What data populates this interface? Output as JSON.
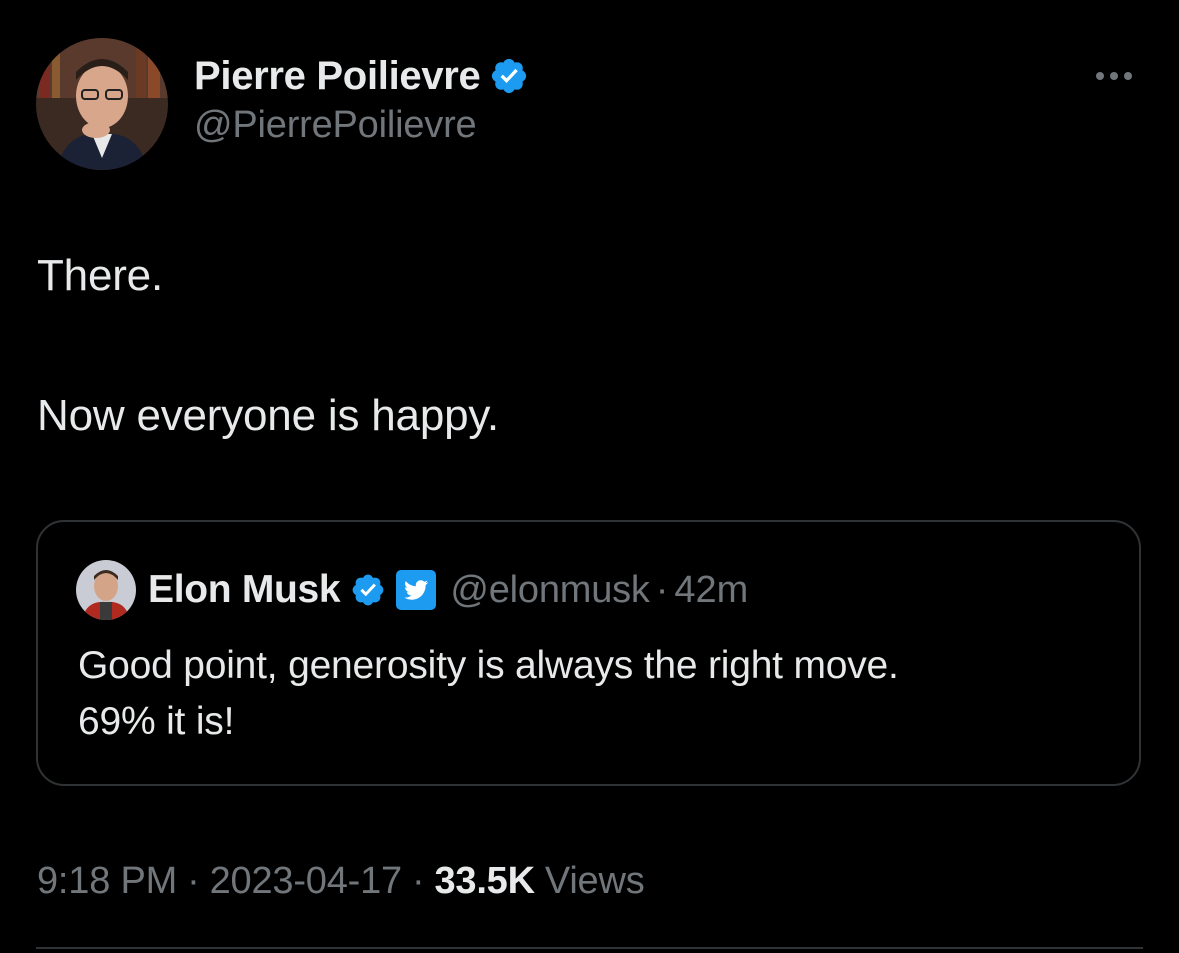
{
  "tweet": {
    "author": {
      "display_name": "Pierre Poilievre",
      "handle": "@PierrePoilievre",
      "verified": true
    },
    "more_icon": "more-horizontal-icon",
    "text_lines": [
      "There.",
      "Now everyone is happy."
    ],
    "quoted": {
      "display_name": "Elon Musk",
      "handle": "@elonmusk",
      "separator": "·",
      "time": "42m",
      "verified": true,
      "affiliate_icon": "twitter-bird-icon",
      "text_lines": [
        "Good point, generosity is always the right move.",
        "69% it is!"
      ]
    },
    "meta": {
      "time": "9:18 PM",
      "sep1": "·",
      "date": "2023-04-17",
      "sep2": "·",
      "views_count": "33.5K",
      "views_label": "Views"
    }
  },
  "colors": {
    "background": "#000000",
    "primary_text": "#e7e9ea",
    "secondary_text": "#71767b",
    "border": "#2f3336",
    "verified_blue": "#1d9bf0"
  }
}
